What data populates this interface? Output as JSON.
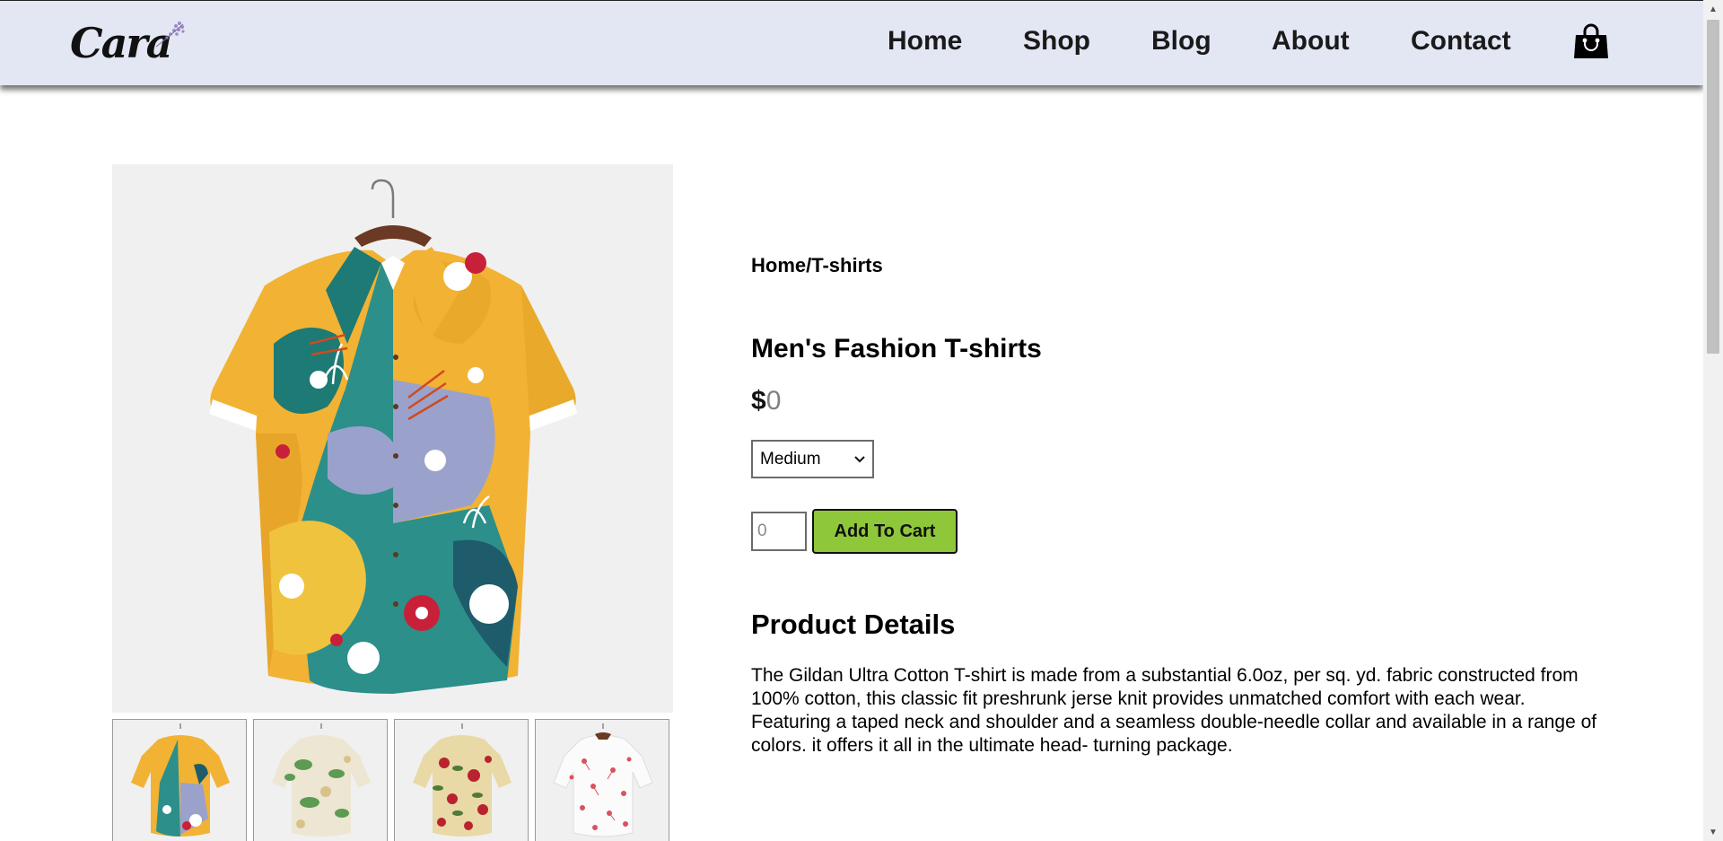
{
  "header": {
    "logo_text": "Cara",
    "nav": [
      {
        "label": "Home"
      },
      {
        "label": "Shop"
      },
      {
        "label": "Blog"
      },
      {
        "label": "About"
      },
      {
        "label": "Contact"
      }
    ],
    "cart_icon": "shopping-bag-icon",
    "background": "#e3e6f3"
  },
  "product": {
    "breadcrumb": "Home/T-shirts",
    "title": "Men's Fashion T-shirts",
    "currency": "$",
    "price": "0",
    "size_selected": "Medium",
    "quantity_placeholder": "0",
    "add_to_cart_label": "Add To Cart",
    "accent": "#8fc73a",
    "details_heading": "Product Details",
    "details_text": "The Gildan Ultra Cotton T-shirt is made from a substantial 6.0oz, per sq. yd. fabric constructed from 100% cotton, this classic fit preshrunk jerse knit provides unmatched comfort with each wear. Featuring a taped neck and shoulder and a seamless double-needle collar and available in a range of colors. it offers it all in the ultimate head- turning package."
  },
  "gallery": {
    "main_image": "shirt-image",
    "thumbnails": [
      {
        "icon": "shirt-thumbnail-icon"
      },
      {
        "icon": "shirt-thumbnail-icon"
      },
      {
        "icon": "shirt-thumbnail-icon"
      },
      {
        "icon": "shirt-thumbnail-icon"
      }
    ]
  }
}
